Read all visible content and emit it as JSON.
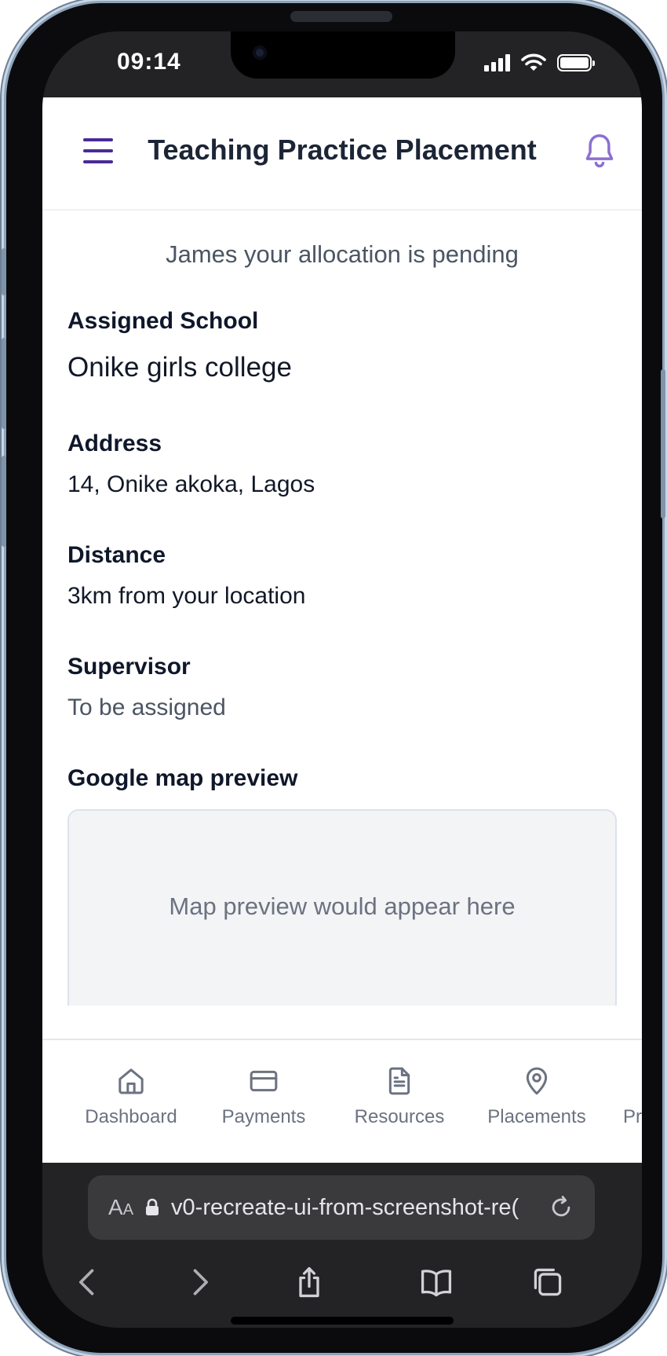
{
  "status_bar": {
    "time": "09:14"
  },
  "header": {
    "title": "Teaching Practice Placement"
  },
  "allocation": {
    "message": "James your allocation is pending",
    "fields": [
      {
        "label": "Assigned School",
        "value": "Onike girls college"
      },
      {
        "label": "Address",
        "value": "14, Onike akoka, Lagos"
      },
      {
        "label": "Distance",
        "value": "3km from your location"
      },
      {
        "label": "Supervisor",
        "value": "To be assigned"
      }
    ],
    "map": {
      "label": "Google map preview",
      "placeholder": "Map preview would appear here"
    }
  },
  "tabs": [
    {
      "label": "Dashboard",
      "icon": "home-icon"
    },
    {
      "label": "Payments",
      "icon": "credit-card-icon"
    },
    {
      "label": "Resources",
      "icon": "document-icon"
    },
    {
      "label": "Placements",
      "icon": "map-pin-icon"
    },
    {
      "label": "Pr",
      "icon": ""
    }
  ],
  "browser": {
    "aa_large": "A",
    "aa_small": "A",
    "url": "v0-recreate-ui-from-screenshot-re("
  },
  "colors": {
    "accent": "#4a2a96",
    "bell": "#8c6fd0",
    "title": "#1c2536",
    "muted": "#6b7280"
  }
}
